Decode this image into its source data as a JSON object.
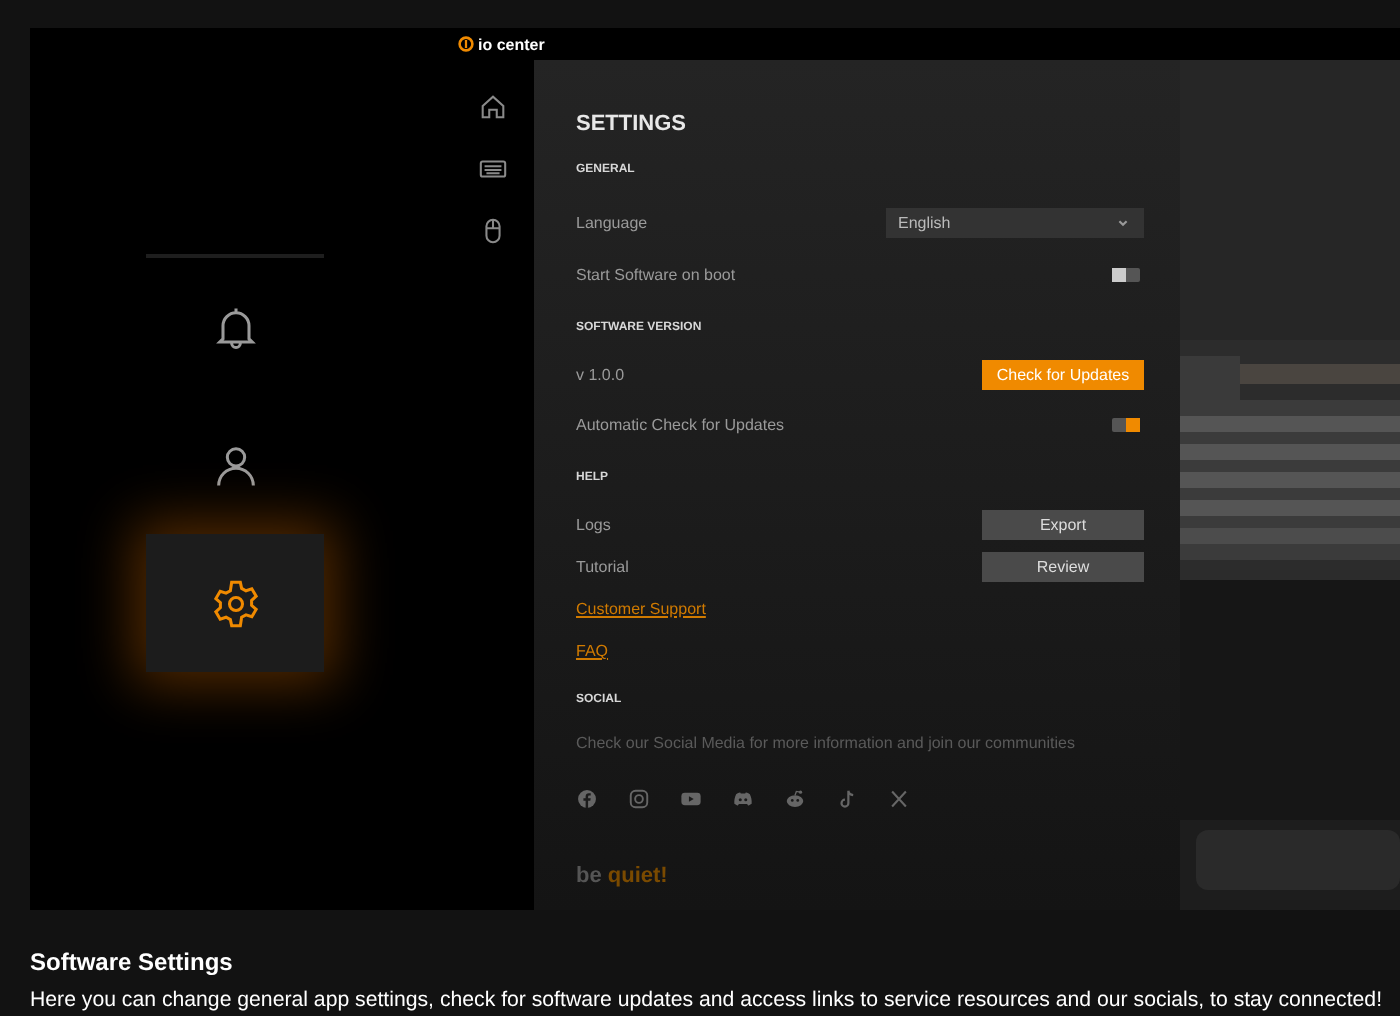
{
  "app": {
    "title": "io center"
  },
  "side_tabs": [
    {
      "selected": false
    },
    {
      "selected": false
    },
    {
      "selected": true
    }
  ],
  "settings": {
    "title": "SETTINGS",
    "sections": [
      {
        "heading": "GENERAL",
        "rows": [
          {
            "kind": "select",
            "label": "Language",
            "value": "English"
          },
          {
            "kind": "toggle",
            "label": "Start Software on boot",
            "on": false
          }
        ]
      },
      {
        "heading": "SOFTWARE VERSION",
        "rows": [
          {
            "kind": "button",
            "label": "v 1.0.0",
            "button": "Check for Updates",
            "primary": true
          },
          {
            "kind": "toggle",
            "label": "Automatic Check for Updates",
            "on": true
          }
        ]
      },
      {
        "heading": "HELP",
        "rows": [
          {
            "kind": "button",
            "label": "Logs",
            "button": "Export",
            "primary": false
          },
          {
            "kind": "button",
            "label": "Tutorial",
            "button": "Review",
            "primary": false
          },
          {
            "kind": "link",
            "label": "Customer Support"
          },
          {
            "kind": "link",
            "label": "FAQ"
          }
        ]
      },
      {
        "heading": "SOCIAL",
        "rows": [
          {
            "kind": "text",
            "label": "Check our Social Media for more information and join our communities"
          },
          {
            "kind": "socials"
          }
        ]
      }
    ]
  },
  "brand": {
    "first": "be",
    "second": "quiet!"
  },
  "caption": {
    "title": "Software Settings",
    "text": "Here you can change general app settings, check for software updates and access links to service resources and our socials, to stay connected!"
  }
}
